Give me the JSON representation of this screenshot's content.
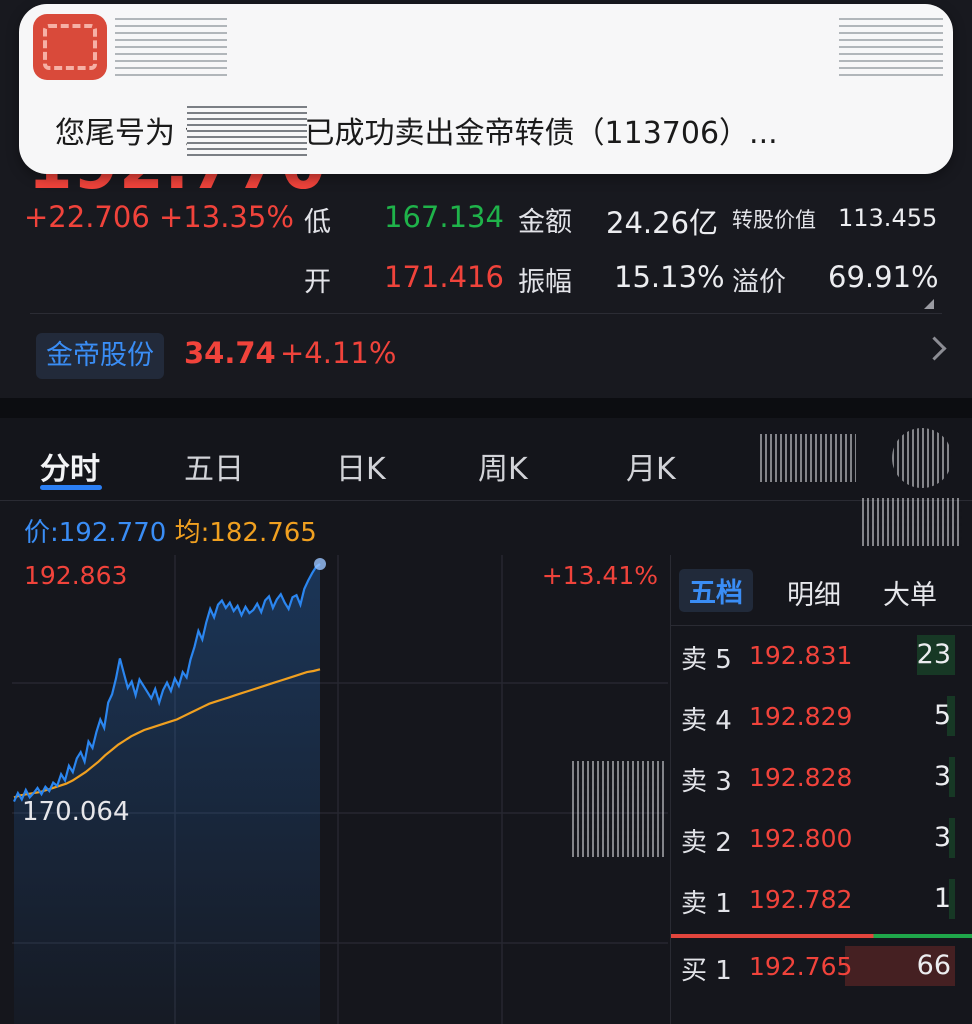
{
  "notification": {
    "text": "您尾号为      资金账号已成功卖出金帝转债（113706）..."
  },
  "quote": {
    "price": "192.770",
    "change": "+22.706",
    "change_pct": "+13.35%",
    "stats": [
      {
        "label": "低",
        "value": "167.134",
        "color": "#1fb34a"
      },
      {
        "label": "金额",
        "value": "24.26亿",
        "color": "#ecedf0"
      },
      {
        "label": "转股价值",
        "value": "113.455",
        "color": "#ecedf0"
      },
      {
        "label": "开",
        "value": "171.416",
        "color": "#f0433b"
      },
      {
        "label": "振幅",
        "value": "15.13%",
        "color": "#ecedf0"
      },
      {
        "label": "溢价",
        "value": "69.91%",
        "color": "#ecedf0"
      }
    ],
    "underlying": {
      "name": "金帝股份",
      "price": "34.74",
      "change_pct": "+4.11%"
    }
  },
  "tabs": [
    "分时",
    "五日",
    "日K",
    "周K",
    "月K"
  ],
  "price_avg": {
    "price_label": "价:",
    "price": "192.770",
    "avg_label": "均:",
    "avg": "182.765"
  },
  "chart": {
    "high_label": "192.863",
    "high_pct": "+13.41%",
    "low_label": "170.064",
    "price_color": "#2b86f0",
    "avg_color": "#f0a020"
  },
  "chart_data": {
    "type": "line",
    "ylim": [
      170.064,
      192.863
    ],
    "series": [
      {
        "values": [
          170.2,
          171.0,
          170.4,
          171.3,
          170.6,
          171.0,
          171.5,
          170.9,
          171.6,
          171.2,
          172.0,
          171.7,
          172.8,
          172.2,
          173.6,
          173.0,
          174.3,
          174.9,
          174.0,
          175.9,
          175.3,
          176.8,
          178.0,
          177.2,
          179.6,
          180.4,
          181.9,
          183.8,
          182.4,
          181.0,
          181.6,
          180.3,
          181.8,
          181.2,
          180.6,
          180.0,
          180.9,
          179.6,
          180.8,
          181.5,
          180.7,
          181.9,
          181.2,
          182.5,
          182.0,
          183.7,
          184.9,
          186.4,
          185.6,
          187.2,
          188.5,
          187.7,
          188.9,
          189.3,
          188.6,
          189.1,
          188.3,
          188.8,
          187.9,
          188.7,
          188.1,
          188.4,
          189.0,
          188.2,
          189.3,
          189.7,
          188.6,
          189.4,
          189.9,
          189.1,
          188.5,
          189.6,
          189.8,
          188.9,
          190.4,
          191.2,
          191.9,
          192.5,
          192.77
        ]
      },
      {
        "values": [
          170.6,
          170.8,
          170.9,
          171.0,
          171.1,
          171.3,
          171.5,
          171.7,
          171.9,
          172.2,
          172.6,
          173.0,
          173.5,
          174.0,
          174.6,
          175.1,
          175.6,
          176.0,
          176.4,
          176.7,
          177.0,
          177.2,
          177.4,
          177.6,
          177.8,
          178.0,
          178.3,
          178.6,
          178.9,
          179.2,
          179.5,
          179.7,
          179.9,
          180.1,
          180.3,
          180.5,
          180.7,
          180.9,
          181.1,
          181.3,
          181.5,
          181.7,
          181.9,
          182.1,
          182.3,
          182.5,
          182.6,
          182.765
        ]
      }
    ]
  },
  "order_book": {
    "tabs": [
      "五档",
      "明细",
      "大单"
    ],
    "rows": [
      {
        "label": "卖 5",
        "price": "192.831",
        "volume": "23"
      },
      {
        "label": "卖 4",
        "price": "192.829",
        "volume": "5"
      },
      {
        "label": "卖 3",
        "price": "192.828",
        "volume": "3"
      },
      {
        "label": "卖 2",
        "price": "192.800",
        "volume": "3"
      },
      {
        "label": "卖 1",
        "price": "192.782",
        "volume": "1"
      },
      {
        "label": "买 1",
        "price": "192.765",
        "volume": "66"
      }
    ]
  }
}
